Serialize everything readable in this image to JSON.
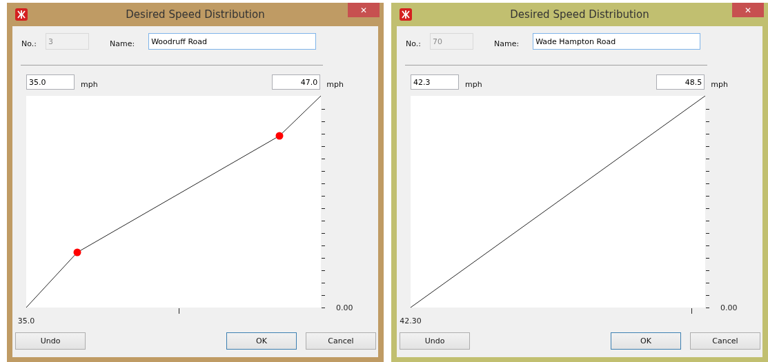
{
  "dialogs": [
    {
      "title": "Desired Speed Distribution",
      "close": "✕",
      "color": "#bf9b64",
      "number": {
        "label": "No.:",
        "value": "3",
        "disabled": true
      },
      "name": {
        "label": "Name:",
        "value": "Woodruff Road",
        "focused": true
      },
      "min": {
        "value": "35.0",
        "unit": "mph"
      },
      "max": {
        "value": "47.0",
        "unit": "mph"
      },
      "graph": {
        "kind": "bent",
        "x_label": "35.0",
        "y_label": "0.00"
      },
      "buttons": [
        {
          "label": "Undo",
          "default": false
        },
        {
          "label": "OK",
          "default": true
        },
        {
          "label": "Cancel",
          "default": false
        }
      ]
    },
    {
      "title": "Desired Speed Distribution",
      "close": "✕",
      "color": "#c1bf70",
      "number": {
        "label": "No.:",
        "value": "70",
        "disabled": true
      },
      "name": {
        "label": "Name:",
        "value": "Wade Hampton Road",
        "focused": true
      },
      "min": {
        "value": "42.3",
        "unit": "mph"
      },
      "max": {
        "value": "48.5",
        "unit": "mph"
      },
      "graph": {
        "kind": "straight",
        "x_label": "42.30",
        "y_label": "0.00"
      },
      "buttons": [
        {
          "label": "Undo",
          "default": false
        },
        {
          "label": "OK",
          "default": true
        },
        {
          "label": "Cancel",
          "default": false
        }
      ]
    }
  ]
}
